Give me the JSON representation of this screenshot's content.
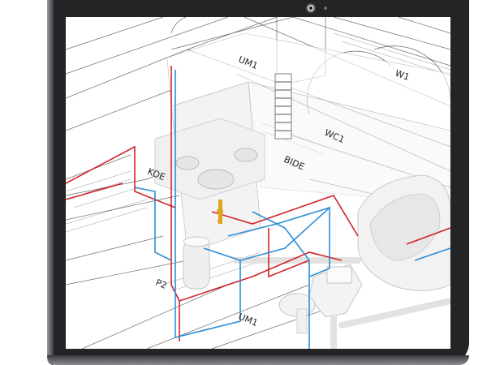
{
  "device": {
    "type": "tablet",
    "frame_color": "#232426"
  },
  "drawing": {
    "labels": [
      {
        "id": "umi-top",
        "text": "UM1"
      },
      {
        "id": "w1",
        "text": "W1"
      },
      {
        "id": "wc1",
        "text": "WC1"
      },
      {
        "id": "bide",
        "text": "BIDE"
      },
      {
        "id": "umi-bottom",
        "text": "UM1"
      },
      {
        "id": "koe",
        "text": "KOE"
      },
      {
        "id": "p2",
        "text": "P2"
      }
    ],
    "colors": {
      "hot_water": "#d2232a",
      "cold_water": "#2b8fd6",
      "sanitary": "#f4f4f4",
      "lines": "#3a3a3a",
      "fitting": "#e0a41c"
    }
  }
}
